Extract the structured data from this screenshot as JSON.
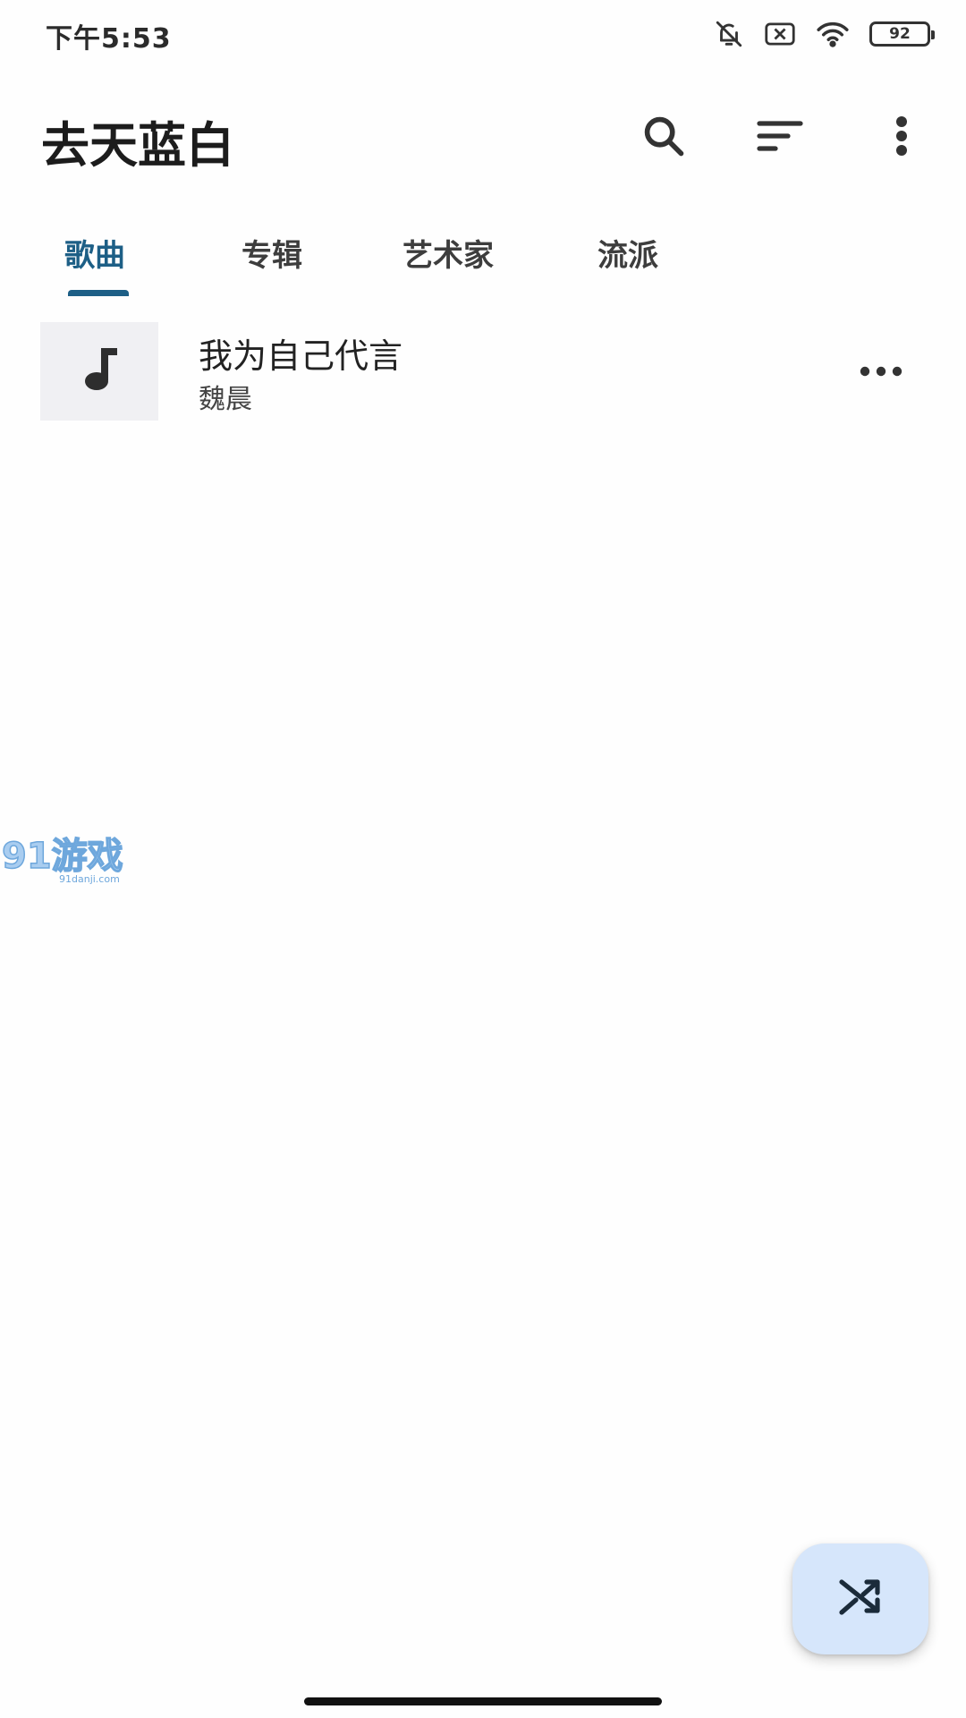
{
  "status_bar": {
    "time": "下午5:53",
    "battery": "92",
    "icons": [
      "bell-off-icon",
      "sim-error-icon",
      "wifi-icon",
      "battery-icon"
    ]
  },
  "app_bar": {
    "title": "去天蓝白",
    "actions": [
      "search-icon",
      "sort-icon",
      "more-vert-icon"
    ]
  },
  "tabs": [
    {
      "label": "歌曲",
      "active": true
    },
    {
      "label": "专辑",
      "active": false
    },
    {
      "label": "艺术家",
      "active": false
    },
    {
      "label": "流派",
      "active": false
    }
  ],
  "songs": [
    {
      "title": "我为自己代言",
      "artist": "魏晨",
      "art_icon": "music-note-icon",
      "menu_icon": "more-horiz-icon"
    }
  ],
  "watermark": {
    "text": "91游戏",
    "sub": "91danji.com"
  },
  "fab": {
    "icon": "shuffle-icon"
  },
  "colors": {
    "accent": "#1d5f86",
    "fab_bg": "#d6e6fb",
    "art_bg": "#f0f0f3"
  }
}
